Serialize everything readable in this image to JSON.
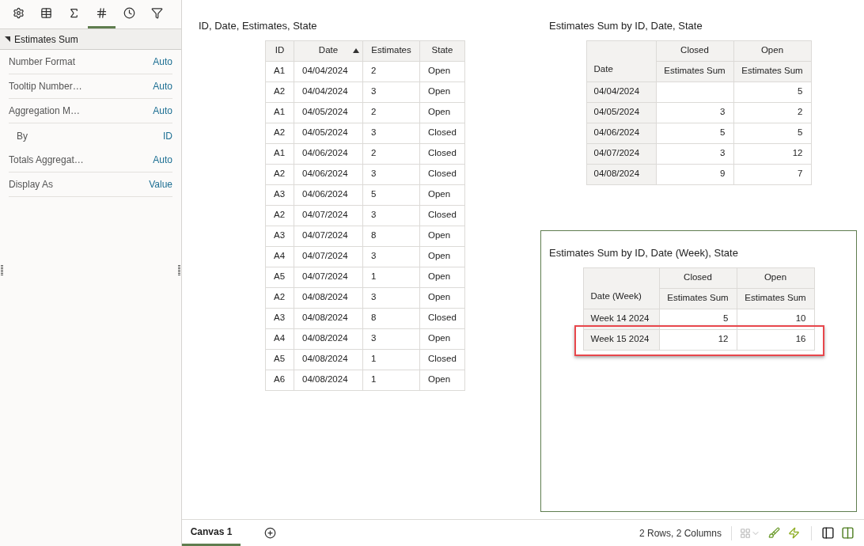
{
  "sidebar": {
    "tabs": [
      {
        "selected": false
      },
      {
        "selected": false
      },
      {
        "selected": false
      },
      {
        "selected": true
      },
      {
        "selected": false
      },
      {
        "selected": false
      }
    ],
    "section": {
      "title": "Estimates Sum",
      "expanded": true
    },
    "properties": [
      {
        "label": "Number Format",
        "value": "Auto"
      },
      {
        "label": "Tooltip Number…",
        "value": "Auto"
      },
      {
        "label": "Aggregation M…",
        "value": "Auto",
        "children": [
          {
            "label": "By",
            "value": "ID"
          }
        ]
      },
      {
        "label": "Totals Aggregat…",
        "value": "Auto"
      },
      {
        "label": "Display As",
        "value": "Value"
      }
    ]
  },
  "visualizations": [
    {
      "kind": "table",
      "title": "ID, Date, Estimates, State",
      "selected": false,
      "columns": [
        {
          "label": "ID",
          "sorted": false
        },
        {
          "label": "Date",
          "sorted": true
        },
        {
          "label": "Estimates",
          "sorted": false
        },
        {
          "label": "State",
          "sorted": false
        }
      ],
      "rows": [
        [
          "A1",
          "04/04/2024",
          "2",
          "Open"
        ],
        [
          "A2",
          "04/04/2024",
          "3",
          "Open"
        ],
        [
          "A1",
          "04/05/2024",
          "2",
          "Open"
        ],
        [
          "A2",
          "04/05/2024",
          "3",
          "Closed"
        ],
        [
          "A1",
          "04/06/2024",
          "2",
          "Closed"
        ],
        [
          "A2",
          "04/06/2024",
          "3",
          "Closed"
        ],
        [
          "A3",
          "04/06/2024",
          "5",
          "Open"
        ],
        [
          "A2",
          "04/07/2024",
          "3",
          "Closed"
        ],
        [
          "A3",
          "04/07/2024",
          "8",
          "Open"
        ],
        [
          "A4",
          "04/07/2024",
          "3",
          "Open"
        ],
        [
          "A5",
          "04/07/2024",
          "1",
          "Open"
        ],
        [
          "A2",
          "04/08/2024",
          "3",
          "Open"
        ],
        [
          "A3",
          "04/08/2024",
          "8",
          "Closed"
        ],
        [
          "A4",
          "04/08/2024",
          "3",
          "Open"
        ],
        [
          "A5",
          "04/08/2024",
          "1",
          "Closed"
        ],
        [
          "A6",
          "04/08/2024",
          "1",
          "Open"
        ]
      ]
    },
    {
      "kind": "pivot",
      "title": "Estimates Sum by ID, Date, State",
      "selected": false,
      "row_header": "Date",
      "column_groups": [
        {
          "label": "Closed",
          "measure": "Estimates Sum"
        },
        {
          "label": "Open",
          "measure": "Estimates Sum"
        }
      ],
      "rows": [
        {
          "label": "04/04/2024",
          "open": "5",
          "highlighted": false
        },
        {
          "label": "04/05/2024",
          "closed": "3",
          "open": "2",
          "highlighted": false
        },
        {
          "label": "04/06/2024",
          "closed": "5",
          "open": "5",
          "highlighted": false
        },
        {
          "label": "04/07/2024",
          "closed": "3",
          "open": "12",
          "highlighted": false
        },
        {
          "label": "04/08/2024",
          "closed": "9",
          "open": "7",
          "highlighted": false
        }
      ]
    },
    {
      "kind": "pivot",
      "title": "Estimates Sum by ID, Date (Week), State",
      "selected": true,
      "row_header": "Date (Week)",
      "column_groups": [
        {
          "label": "Closed",
          "measure": "Estimates Sum"
        },
        {
          "label": "Open",
          "measure": "Estimates Sum"
        }
      ],
      "rows": [
        {
          "label": "Week 14 2024",
          "closed": "5",
          "open": "10",
          "highlighted": false
        },
        {
          "label": "Week 15 2024",
          "closed": "12",
          "open": "16",
          "highlighted": true
        }
      ]
    }
  ],
  "canvas_tabs": [
    {
      "label": "Canvas 1",
      "selected": true
    }
  ],
  "status": "2 Rows, 2 Columns"
}
